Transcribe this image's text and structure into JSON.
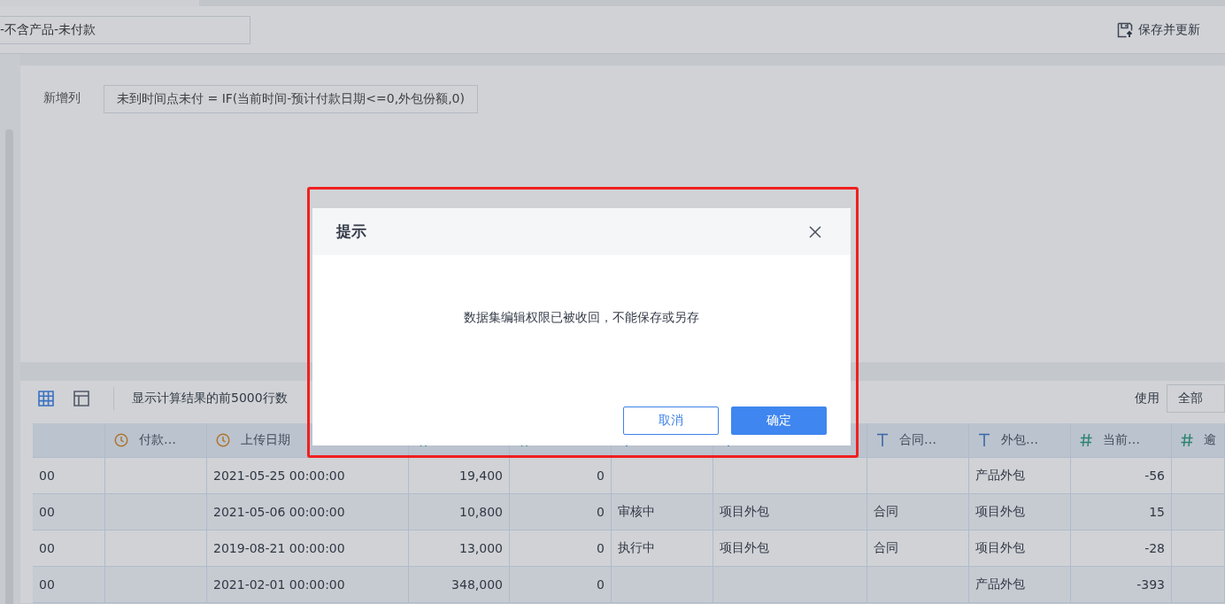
{
  "header": {
    "name_field": "-不含产品-未付款",
    "save_button": "保存并更新"
  },
  "formula": {
    "label": "新增列",
    "expression": "未到时间点未付 = IF(当前时间-预计付款日期<=0,外包份额,0)"
  },
  "toolbar": {
    "views": [
      {
        "kind": "grid",
        "selected": true
      },
      {
        "kind": "layout",
        "selected": false
      }
    ],
    "info": "显示计算结果的前5000行数",
    "use_label": "使用",
    "use_value": "全部"
  },
  "table": {
    "columns": [
      {
        "kind": "plain"
      },
      {
        "kind": "time",
        "label": "付款…"
      },
      {
        "kind": "time",
        "label": "上传日期"
      },
      {
        "kind": "number"
      },
      {
        "kind": "number"
      },
      {
        "kind": "text"
      },
      {
        "kind": "text"
      },
      {
        "kind": "text",
        "label": "合同…"
      },
      {
        "kind": "text",
        "label": "外包…"
      },
      {
        "kind": "number",
        "label": "当前…"
      },
      {
        "kind": "number",
        "label": "逾"
      }
    ],
    "rows": [
      [
        "00",
        "",
        "2021-05-25 00:00:00",
        "19,400",
        "0",
        "",
        "",
        "",
        "产品外包",
        "-56",
        ""
      ],
      [
        "00",
        "",
        "2021-05-06 00:00:00",
        "10,800",
        "0",
        "审核中",
        "项目外包",
        "合同",
        "项目外包",
        "15",
        ""
      ],
      [
        "00",
        "",
        "2019-08-21 00:00:00",
        "13,000",
        "0",
        "执行中",
        "项目外包",
        "合同",
        "项目外包",
        "-28",
        ""
      ],
      [
        "00",
        "",
        "2021-02-01 00:00:00",
        "348,000",
        "0",
        "",
        "",
        "",
        "产品外包",
        "-393",
        ""
      ]
    ]
  },
  "dialog": {
    "title": "提示",
    "message": "数据集编辑权限已被收回，不能保存或另存",
    "buttons": [
      {
        "kind": "secondary",
        "label": "取消"
      },
      {
        "kind": "primary",
        "label": "确定"
      }
    ]
  }
}
